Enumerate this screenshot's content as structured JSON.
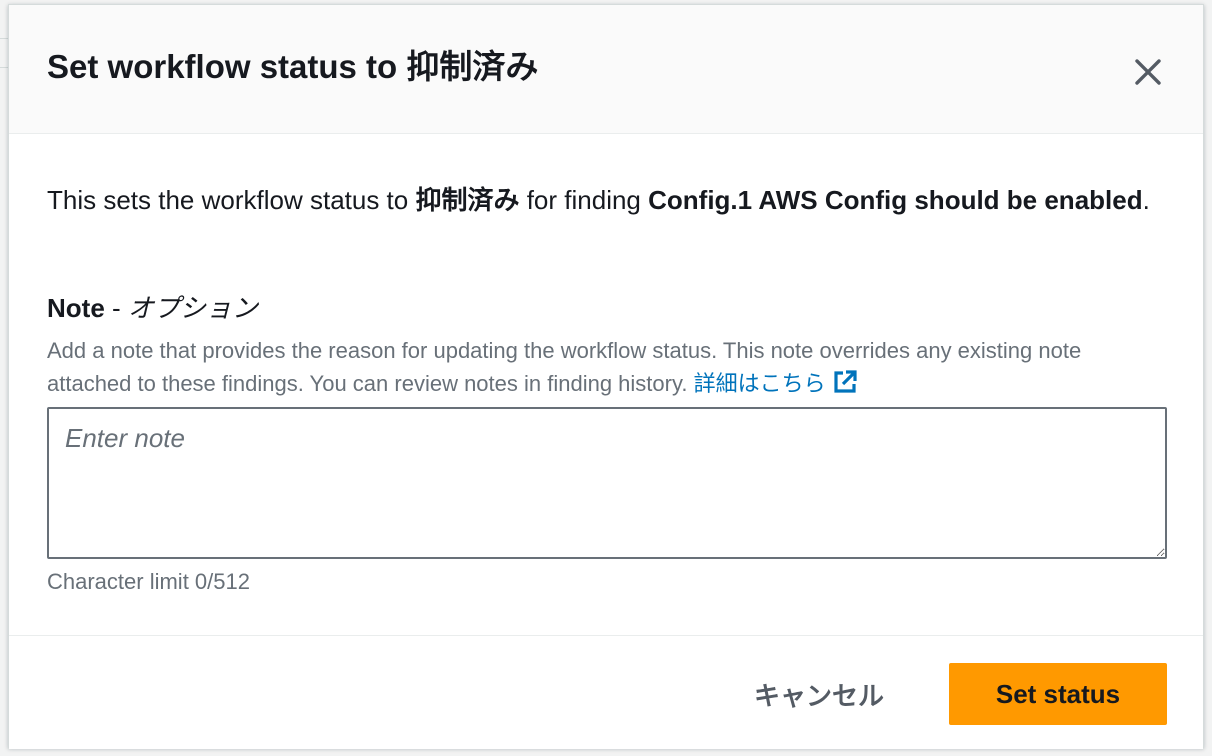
{
  "dialog": {
    "title": "Set workflow status to 抑制済み",
    "close_icon": "close-icon",
    "body": {
      "intro_prefix": "This sets the workflow status to ",
      "status_value": "抑制済み",
      "intro_middle": " for finding ",
      "finding_name": "Config.1 AWS Config should be enabled",
      "intro_suffix": "."
    },
    "note_field": {
      "label": "Note",
      "label_separator": " - ",
      "optional_text": "オプション",
      "description": "Add a note that provides the reason for updating the workflow status. This note overrides any existing note attached to these findings. You can review notes in finding history. ",
      "learn_more_link": "詳細はこちら",
      "link_icon": "external-link-icon",
      "placeholder": "Enter note",
      "value": "",
      "character_limit_text": "Character limit 0/512"
    },
    "footer": {
      "cancel_label": "キャンセル",
      "submit_label": "Set status"
    }
  },
  "colors": {
    "primary_button": "#ff9900",
    "link": "#0073bb",
    "text": "#16191f",
    "secondary_text": "#687078"
  }
}
